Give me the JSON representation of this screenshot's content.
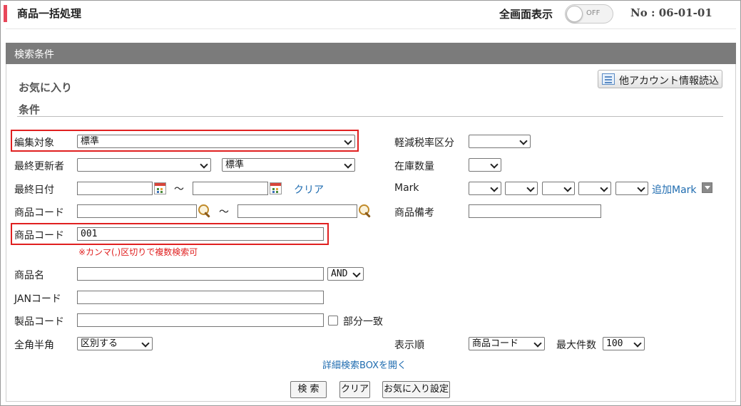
{
  "header": {
    "title": "商品一括処理",
    "fullscreen_label": "全画面表示",
    "toggle_state": "OFF",
    "screen_no": "No : 06-01-01"
  },
  "section": {
    "title": "検索条件"
  },
  "favorites": {
    "heading": "お気に入り",
    "account_button": "他アカウント情報読込"
  },
  "conditions": {
    "heading": "条件",
    "edit_target": {
      "label": "編集対象",
      "value": "標準"
    },
    "last_updater": {
      "label": "最終更新者",
      "value": "",
      "value2": "標準"
    },
    "last_date": {
      "label": "最終日付",
      "from": "",
      "to": "",
      "tilde": "〜",
      "clear": "クリア"
    },
    "product_code_range": {
      "label": "商品コード",
      "from": "",
      "to": "",
      "tilde": "〜"
    },
    "product_code_multi": {
      "label": "商品コード",
      "value": "001",
      "note": "※カンマ(,)区切りで複数検索可"
    },
    "product_name": {
      "label": "商品名",
      "value": "",
      "operator": "AND"
    },
    "jan_code": {
      "label": "JANコード",
      "value": ""
    },
    "maker_code": {
      "label": "製品コード",
      "value": "",
      "partial_label": "部分一致"
    },
    "width_mode": {
      "label": "全角半角",
      "value": "区別する"
    },
    "reduced_tax": {
      "label": "軽減税率区分",
      "value": ""
    },
    "stock_qty": {
      "label": "在庫数量",
      "value": ""
    },
    "mark": {
      "label": "Mark",
      "values": [
        "",
        "",
        "",
        "",
        ""
      ],
      "add_label": "追加Mark"
    },
    "product_remarks": {
      "label": "商品備考",
      "value": ""
    },
    "sort_order": {
      "label": "表示順",
      "value": "商品コード"
    },
    "max_count": {
      "label": "最大件数",
      "value": "100"
    }
  },
  "detail_link": "詳細検索BOXを開く",
  "actions": {
    "search": "検 索",
    "clear": "クリア",
    "fav_settings": "お気に入り設定"
  }
}
